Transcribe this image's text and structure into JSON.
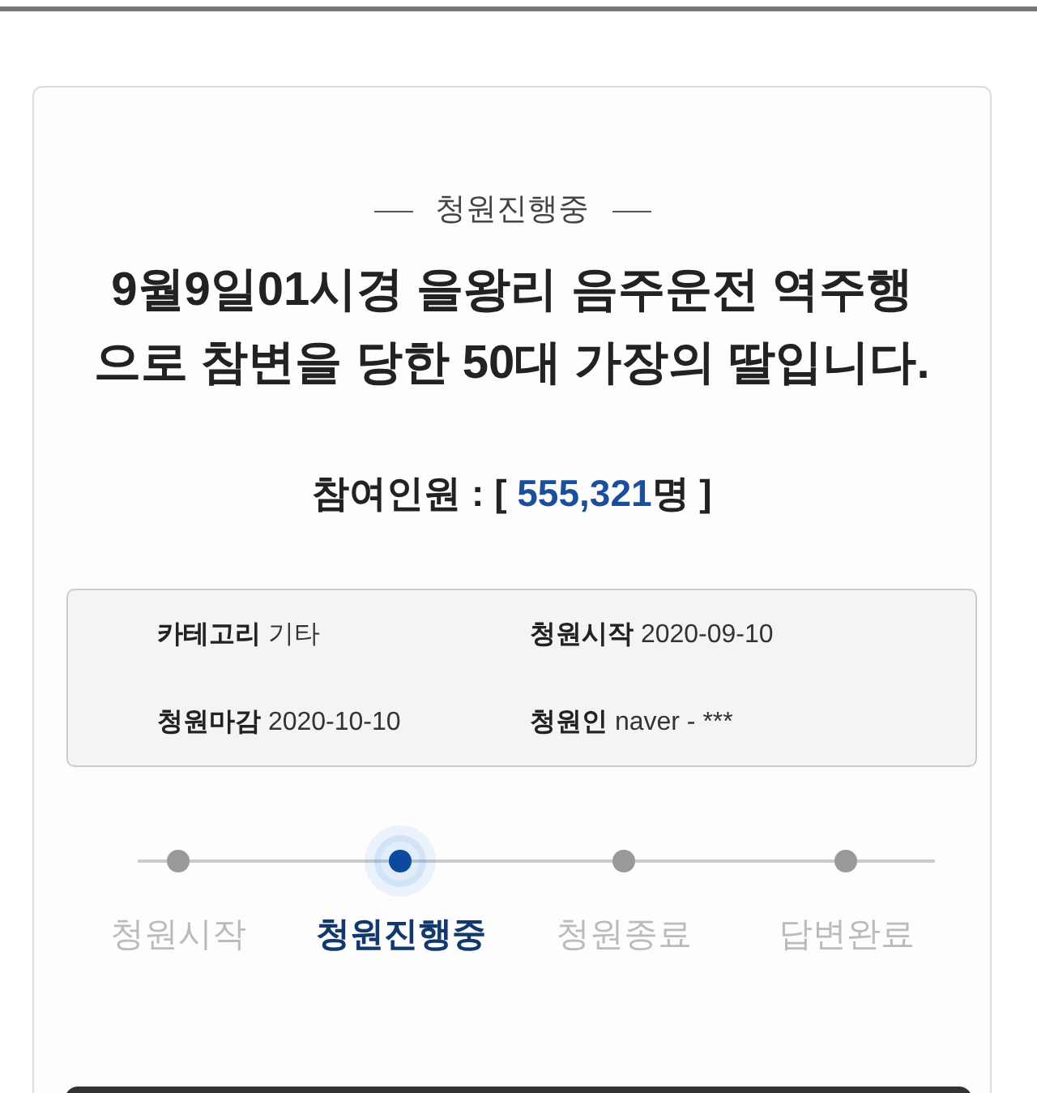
{
  "status_heading": "청원진행중",
  "title": "9월9일01시경 을왕리 음주운전 역주행으로 참변을 당한 50대 가장의 딸입니다.",
  "participants": {
    "label": "참여인원 :",
    "open": "[",
    "value": "555,321",
    "unit": "명",
    "close": "]"
  },
  "info": [
    {
      "label": "카테고리",
      "value": "기타"
    },
    {
      "label": "청원시작",
      "value": "2020-09-10"
    },
    {
      "label": "청원마감",
      "value": "2020-10-10"
    },
    {
      "label": "청원인",
      "value": "naver - ***"
    }
  ],
  "steps": [
    {
      "label": "청원시작",
      "selected": false
    },
    {
      "label": "청원진행중",
      "selected": true
    },
    {
      "label": "청원종료",
      "selected": false
    },
    {
      "label": "답변완료",
      "selected": false
    }
  ]
}
